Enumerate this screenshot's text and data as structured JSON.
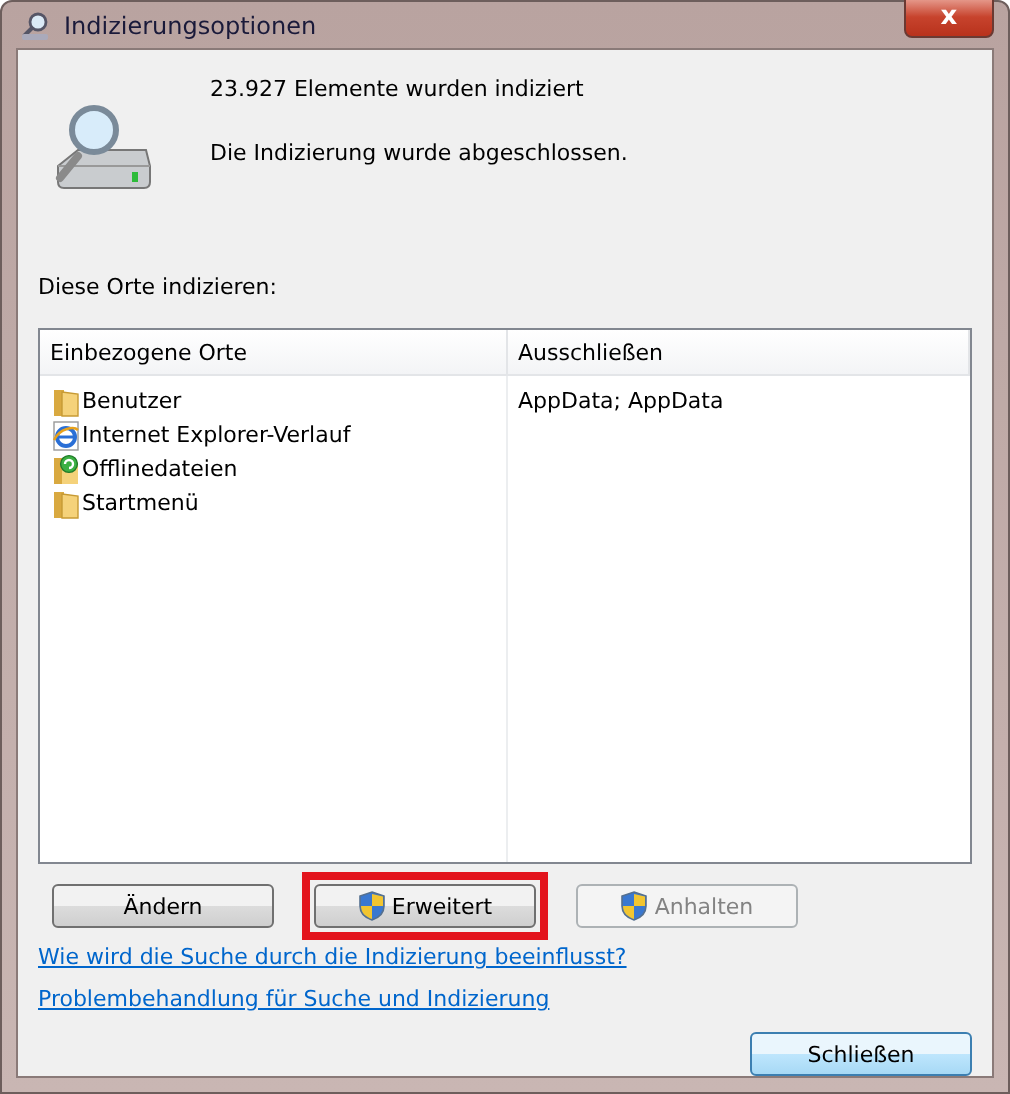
{
  "window": {
    "title": "Indizierungsoptionen",
    "close_label": "x"
  },
  "status": {
    "count_text": "23.927 Elemente wurden indiziert",
    "state_text": "Die Indizierung wurde abgeschlossen."
  },
  "locations_label": "Diese Orte indizieren:",
  "table": {
    "columns": [
      "Einbezogene Orte",
      "Ausschließen"
    ],
    "rows": [
      {
        "kind": "folder",
        "name": "Benutzer",
        "exclude": "AppData; AppData"
      },
      {
        "kind": "browser",
        "name": "Internet Explorer-Verlauf"
      },
      {
        "kind": "offline",
        "name": "Offlinedateien"
      },
      {
        "kind": "folder",
        "name": "Startmenü"
      }
    ]
  },
  "buttons": [
    {
      "label": "Ändern",
      "shield": false,
      "disabled": false,
      "highlighted": false
    },
    {
      "label": "Erweitert",
      "shield": true,
      "disabled": false,
      "highlighted": true
    },
    {
      "label": "Anhalten",
      "shield": true,
      "disabled": true,
      "highlighted": false
    }
  ],
  "links": [
    "Wie wird die Suche durch die Indizierung beeinflusst?",
    "Problembehandlung für Suche und Indizierung"
  ],
  "close_button": "Schließen"
}
